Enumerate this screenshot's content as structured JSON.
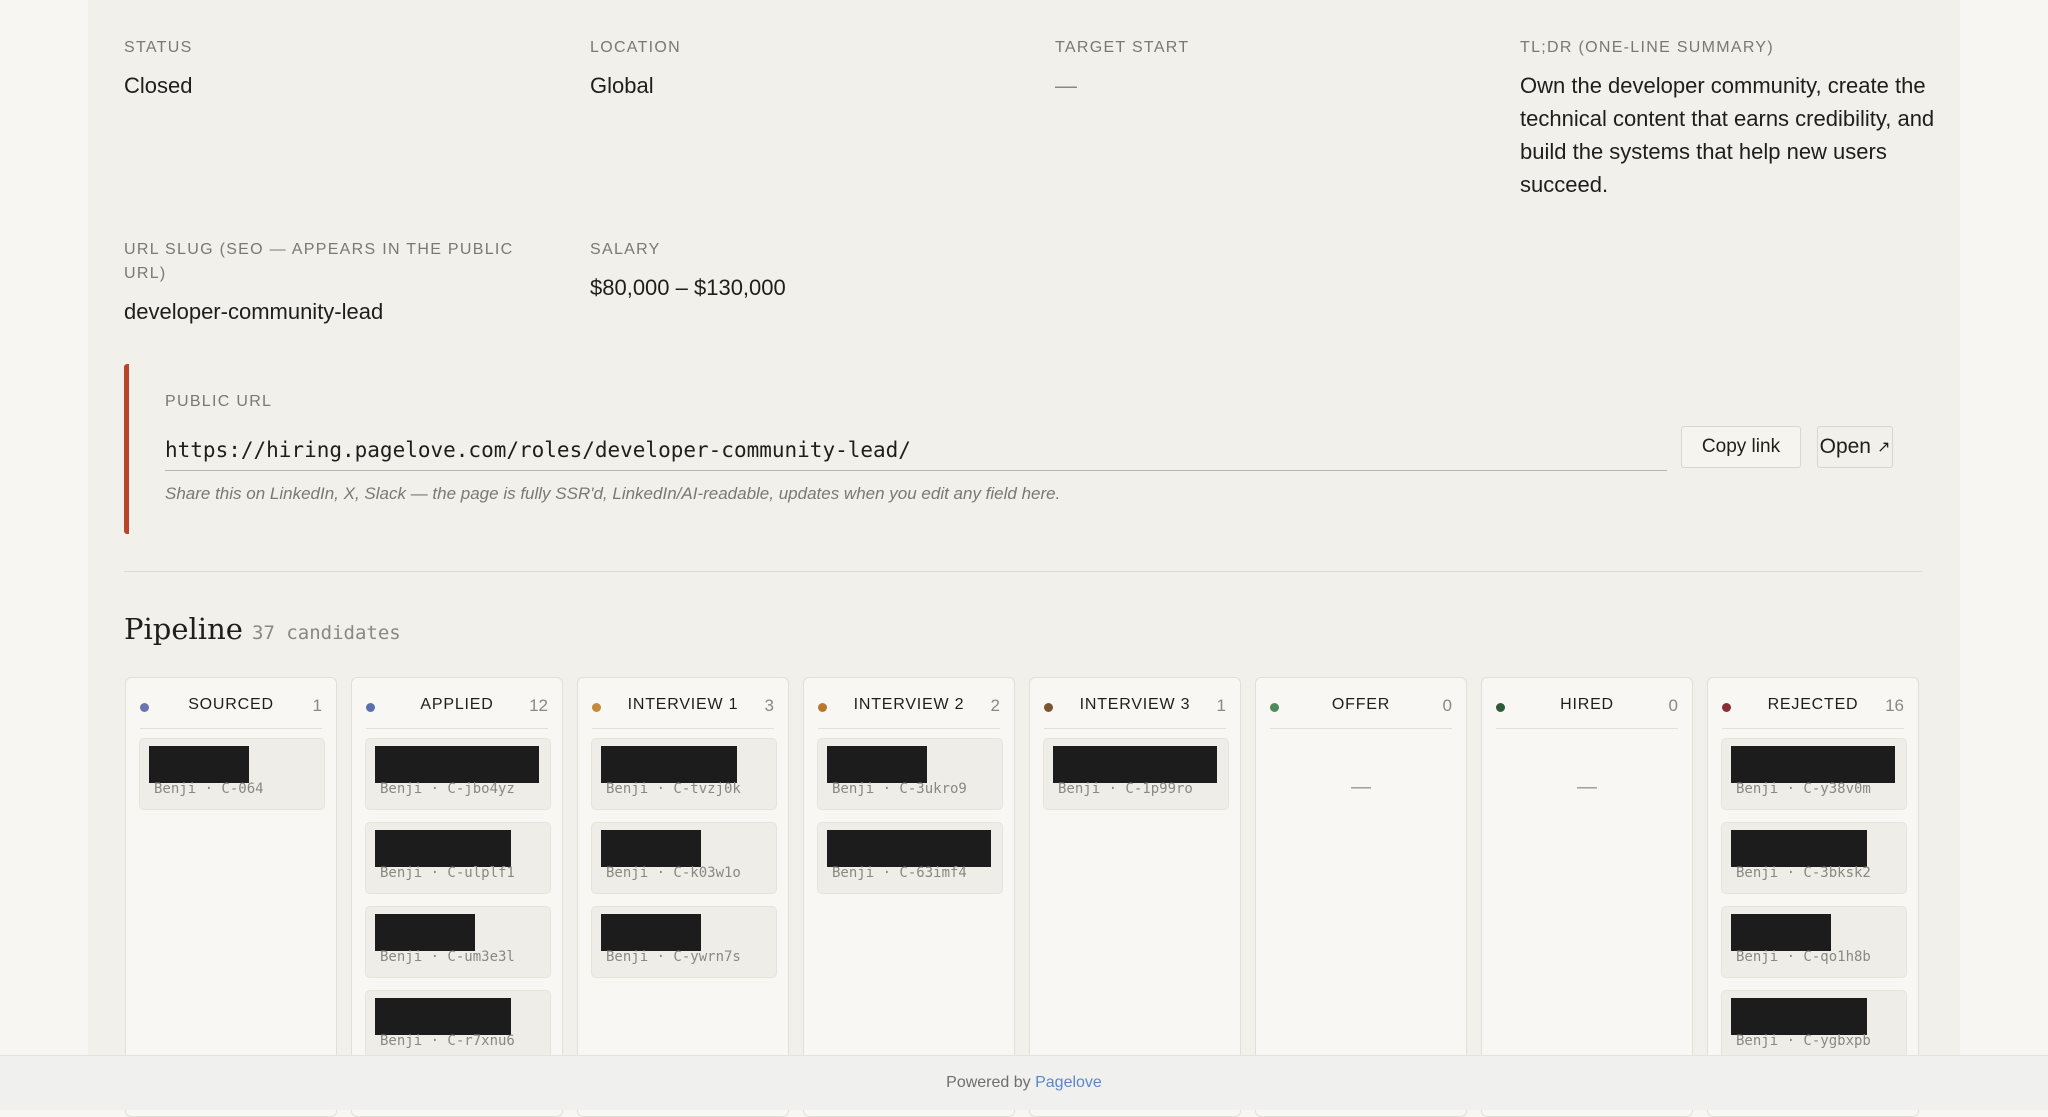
{
  "fields": {
    "status": {
      "label": "STATUS",
      "value": "Closed"
    },
    "location": {
      "label": "LOCATION",
      "value": "Global"
    },
    "target_start": {
      "label": "TARGET START",
      "value": "—"
    },
    "tldr": {
      "label": "TL;DR (ONE-LINE SUMMARY)",
      "value": "Own the developer community, create the technical content that earns credibility, and build the systems that help new users succeed."
    },
    "url_slug": {
      "label": "URL SLUG (SEO — APPEARS IN THE PUBLIC URL)",
      "value": "developer-community-lead"
    },
    "salary": {
      "label": "SALARY",
      "value": "$80,000 – $130,000"
    }
  },
  "public_url": {
    "label": "PUBLIC URL",
    "url": "https://hiring.pagelove.com/roles/developer-community-lead/",
    "copy_label": "Copy link",
    "open_label": "Open",
    "open_icon": "external-arrow-icon",
    "hint": "Share this on LinkedIn, X, Slack — the page is fully SSR'd, LinkedIn/AI-readable, updates when you edit any field here.",
    "accent_color": "#b8452a"
  },
  "pipeline": {
    "title": "Pipeline",
    "count_label": "37 candidates",
    "empty_label": "—",
    "columns": [
      {
        "name": "SOURCED",
        "count": "1",
        "dot_color": "#6b74b0",
        "cards": [
          {
            "meta": "Benji · C-064"
          }
        ]
      },
      {
        "name": "APPLIED",
        "count": "12",
        "dot_color": "#5a6fb0",
        "cards": [
          {
            "meta": "Benji · C-jbo4yz"
          },
          {
            "meta": "Benji · C-ulplf1"
          },
          {
            "meta": "Benji · C-um3e3l"
          },
          {
            "meta": "Benji · C-r7xnu6"
          }
        ]
      },
      {
        "name": "INTERVIEW 1",
        "count": "3",
        "dot_color": "#c28a3a",
        "cards": [
          {
            "meta": "Benji · C-tvzj0k"
          },
          {
            "meta": "Benji · C-k03w1o"
          },
          {
            "meta": "Benji · C-ywrn7s"
          }
        ]
      },
      {
        "name": "INTERVIEW 2",
        "count": "2",
        "dot_color": "#b8782e",
        "cards": [
          {
            "meta": "Benji · C-3ukro9"
          },
          {
            "meta": "Benji · C-63imf4"
          }
        ]
      },
      {
        "name": "INTERVIEW 3",
        "count": "1",
        "dot_color": "#7a5530",
        "cards": [
          {
            "meta": "Benji · C-1p99ro"
          }
        ]
      },
      {
        "name": "OFFER",
        "count": "0",
        "dot_color": "#4f8a5a",
        "cards": []
      },
      {
        "name": "HIRED",
        "count": "0",
        "dot_color": "#2e5a3a",
        "cards": []
      },
      {
        "name": "REJECTED",
        "count": "16",
        "dot_color": "#8a2f35",
        "cards": [
          {
            "meta": "Benji · C-y38v0m"
          },
          {
            "meta": "Benji · C-3bksk2"
          },
          {
            "meta": "Benji · C-qo1h8b"
          },
          {
            "meta": "Benji · C-ygbxpb"
          }
        ]
      }
    ]
  },
  "footer": {
    "prefix": "Powered by",
    "link_label": "Pagelove"
  }
}
